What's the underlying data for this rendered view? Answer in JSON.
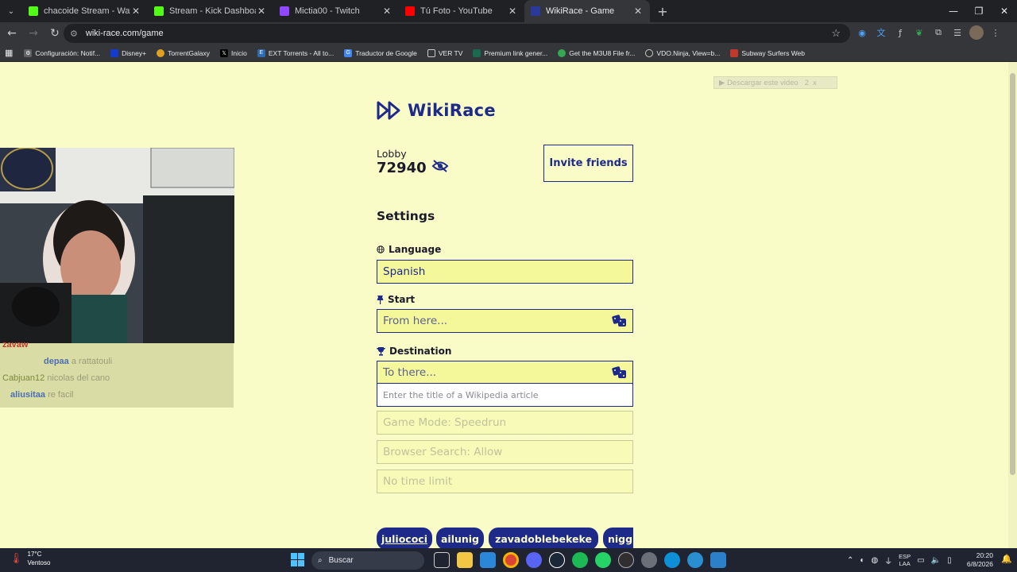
{
  "browser": {
    "tabs": [
      {
        "title": "chacoide Stream - Watch Live o",
        "favicon_color": "#53fc18",
        "active": false
      },
      {
        "title": "Stream - Kick Dashboard",
        "favicon_color": "#53fc18",
        "active": false
      },
      {
        "title": "Mictia00 - Twitch",
        "favicon_color": "#9146ff",
        "active": false
      },
      {
        "title": "Tú Foto - YouTube",
        "favicon_color": "#ff0000",
        "active": false
      },
      {
        "title": "WikiRace - Game",
        "favicon_color": "#2b3a9a",
        "active": true
      }
    ],
    "url": "wiki-race.com/game",
    "bookmarks": [
      {
        "label": "Configuración: Notif...",
        "icon": "gear-icon",
        "color": "#9aa0a6"
      },
      {
        "label": "Disney+",
        "icon": "disney-icon",
        "color": "#113ccf"
      },
      {
        "label": "TorrentGalaxy",
        "icon": "galaxy-icon",
        "color": "#e0a020"
      },
      {
        "label": "Inicio",
        "icon": "x-icon",
        "color": "#000000"
      },
      {
        "label": "EXT Torrents - All to...",
        "icon": "ext-icon",
        "color": "#2d6ab0"
      },
      {
        "label": "Traductor de Google",
        "icon": "translate-icon",
        "color": "#4285f4"
      },
      {
        "label": "VER TV",
        "icon": "folder-icon",
        "color": "#9aa0a6"
      },
      {
        "label": "Premium link gener...",
        "icon": "link-icon",
        "color": "#1a6a50"
      },
      {
        "label": "Get the M3U8 File fr...",
        "icon": "m3u8-icon",
        "color": "#34a853"
      },
      {
        "label": "VDO.Ninja, View=b...",
        "icon": "vdo-icon",
        "color": "#333333"
      },
      {
        "label": "Subway Surfers Web",
        "icon": "subway-icon",
        "color": "#c0392b"
      }
    ]
  },
  "overlay": {
    "download_label": "▶ Descargar este video",
    "count": "2",
    "close": "x"
  },
  "chat": [
    {
      "user": "zavaw",
      "message": "",
      "user_color": "#c0392b"
    },
    {
      "user": "depaa",
      "message": "a rattatouli",
      "user_color": "#4b6fb0"
    },
    {
      "user": "Cabjuan12",
      "message": "nicolas del cano",
      "user_color": "#7a8a3a"
    },
    {
      "user": "aliusitaa",
      "message": "re facil",
      "user_color": "#4b6fb0"
    }
  ],
  "app": {
    "name": "WikiRace",
    "lobby_label": "Lobby",
    "lobby_id": "72940",
    "invite_label": "Invite friends",
    "settings_title": "Settings",
    "language_label": "Language",
    "language_value": "Spanish",
    "start_label": "Start",
    "start_placeholder": "From here...",
    "destination_label": "Destination",
    "destination_placeholder": "To there...",
    "search_placeholder": "Enter the title of a Wikipedia article",
    "game_mode": "Game Mode: Speedrun",
    "browser_search": "Browser Search: Allow",
    "time_limit": "No time limit",
    "players": [
      "juliococi",
      "ailunig",
      "zavadoblebekeke",
      "nigg"
    ],
    "accent_color": "#1e2a8a",
    "background_color": "#fafcc8"
  },
  "taskbar": {
    "temperature": "17°C",
    "weather": "Ventoso",
    "search_label": "Buscar",
    "lang_line1": "ESP",
    "lang_line2": "LAA",
    "time": "20:20",
    "date": "6/8/2026"
  }
}
